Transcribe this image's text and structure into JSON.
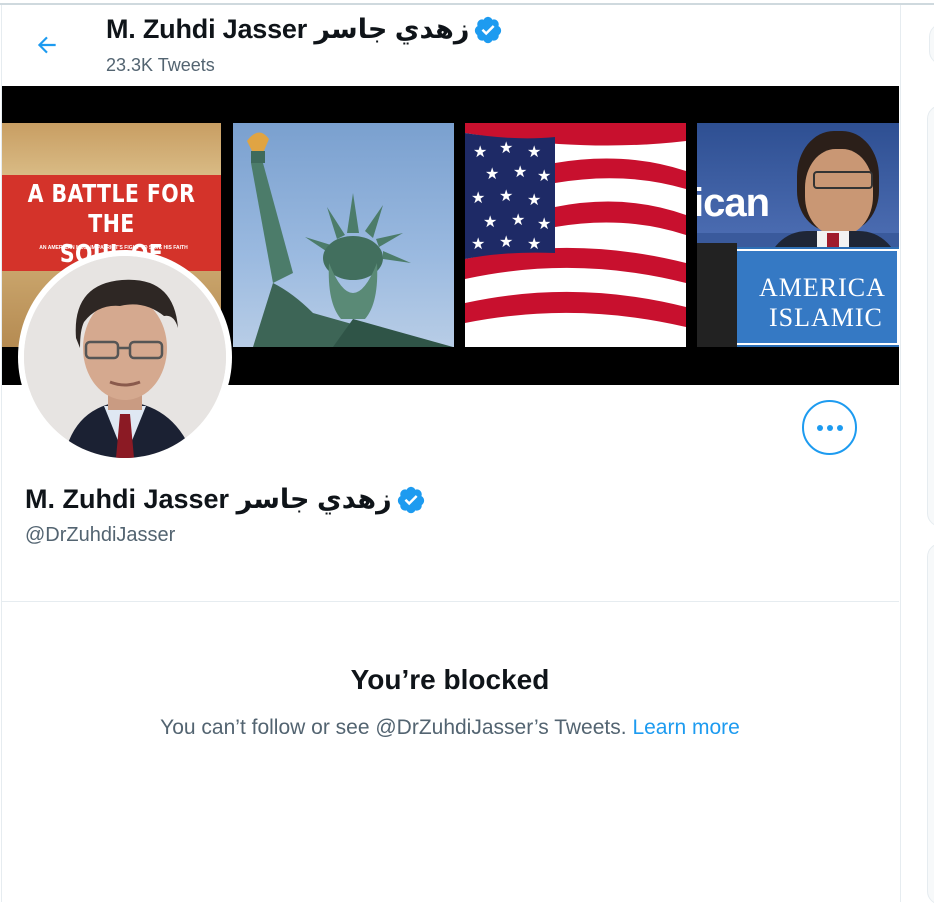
{
  "header": {
    "display_name": "M. Zuhdi Jasser زهدي جاسر",
    "tweet_count": "23.3K Tweets"
  },
  "banner": {
    "book_title_line1": "A BATTLE FOR THE",
    "book_title_line2": "SOUL OF ISLAM",
    "book_subtitle": "AN AMERICAN MUSLIM PATRIOT'S FIGHT TO SAVE HIS FAITH",
    "sign_line1": "AMERICA",
    "sign_line2": "ISLAMIC",
    "backdrop_text": "ican"
  },
  "profile": {
    "display_name": "M. Zuhdi Jasser زهدي جاسر",
    "handle": "@DrZuhdiJasser"
  },
  "blocked": {
    "title": "You’re blocked",
    "message": "You can’t follow or see @DrZuhdiJasser’s Tweets.",
    "link": "Learn more"
  },
  "colors": {
    "accent": "#1d9bf0",
    "verified": "#1d9bf0",
    "text_primary": "#0f1419",
    "text_secondary": "#536471"
  },
  "icons": {
    "back": "back-arrow-icon",
    "verified": "verified-badge-icon",
    "more": "more-options-icon"
  }
}
